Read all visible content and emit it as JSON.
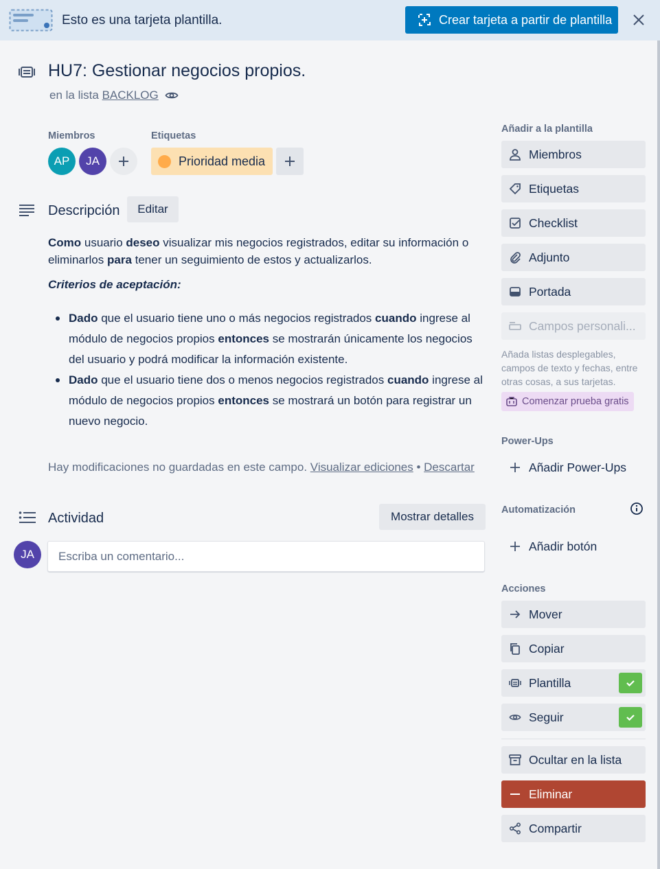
{
  "banner": {
    "text": "Esto es una tarjeta plantilla.",
    "create_label": "Crear tarjeta a partir de plantilla"
  },
  "card": {
    "title": "HU7: Gestionar negocios propios.",
    "in_list_prefix": "en la lista",
    "list_name": "BACKLOG"
  },
  "members": {
    "label": "Miembros",
    "avatars": [
      {
        "initials": "AP",
        "color": "#0b9eb3"
      },
      {
        "initials": "JA",
        "color": "#5243aa"
      }
    ]
  },
  "labels": {
    "label": "Etiquetas",
    "items": [
      {
        "text": "Prioridad media",
        "color": "#ffab4a"
      }
    ]
  },
  "description": {
    "title": "Descripción",
    "edit_label": "Editar",
    "intro": [
      {
        "t": "Como",
        "b": true
      },
      {
        "t": " usuario ",
        "b": false
      },
      {
        "t": "deseo",
        "b": true
      },
      {
        "t": " visualizar mis negocios registrados, editar su información o eliminarlos ",
        "b": false
      },
      {
        "t": "para",
        "b": true
      },
      {
        "t": " tener un seguimiento de estos y actualizarlos.",
        "b": false
      }
    ],
    "criteria_title": "Criterios de aceptación:",
    "criteria": [
      [
        {
          "t": "Dado",
          "b": true
        },
        {
          "t": " que el usuario tiene uno o más negocios registrados ",
          "b": false
        },
        {
          "t": "cuando",
          "b": true
        },
        {
          "t": " ingrese al módulo de negocios propios ",
          "b": false
        },
        {
          "t": "entonces",
          "b": true
        },
        {
          "t": " se mostrarán únicamente los negocios del usuario y podrá modificar la información existente.",
          "b": false
        }
      ],
      [
        {
          "t": "Dado",
          "b": true
        },
        {
          "t": " que el usuario tiene dos o menos negocios registrados ",
          "b": false
        },
        {
          "t": "cuando",
          "b": true
        },
        {
          "t": " ingrese al módulo de negocios propios ",
          "b": false
        },
        {
          "t": "entonces",
          "b": true
        },
        {
          "t": " se mostrará un botón para registrar un nuevo negocio.",
          "b": false
        }
      ]
    ],
    "unsaved_text": "Hay modificaciones no guardadas en este campo.",
    "view_edits_label": "Visualizar ediciones",
    "separator": "•",
    "discard_label": "Descartar"
  },
  "activity": {
    "title": "Actividad",
    "show_details_label": "Mostrar detalles",
    "user_initials": "JA",
    "user_color": "#5243aa",
    "comment_placeholder": "Escriba un comentario..."
  },
  "sidebar": {
    "add_to_template_title": "Añadir a la plantilla",
    "add_items": [
      {
        "label": "Miembros",
        "icon": "person-icon"
      },
      {
        "label": "Etiquetas",
        "icon": "tag-icon"
      },
      {
        "label": "Checklist",
        "icon": "checklist-icon"
      },
      {
        "label": "Adjunto",
        "icon": "paperclip-icon"
      },
      {
        "label": "Portada",
        "icon": "cover-icon"
      },
      {
        "label": "Campos personali...",
        "icon": "custom-fields-icon"
      }
    ],
    "custom_fields_note": "Añada listas desplegables, campos de texto y fechas, entre otras cosas, a sus tarjetas.",
    "trial_label": "Comenzar prueba gratis",
    "powerups_title": "Power-Ups",
    "add_powerups_label": "Añadir Power-Ups",
    "automation_title": "Automatización",
    "add_button_label": "Añadir botón",
    "actions_title": "Acciones",
    "actions": [
      {
        "label": "Mover",
        "icon": "arrow-right-icon"
      },
      {
        "label": "Copiar",
        "icon": "copy-icon"
      },
      {
        "label": "Plantilla",
        "icon": "template-icon",
        "checked": true
      },
      {
        "label": "Seguir",
        "icon": "eye-icon",
        "checked": true
      }
    ],
    "archive_label": "Ocultar en la lista",
    "delete_label": "Eliminar",
    "share_label": "Compartir",
    "check_color": "#61bd4f",
    "danger_color": "#b04632"
  }
}
